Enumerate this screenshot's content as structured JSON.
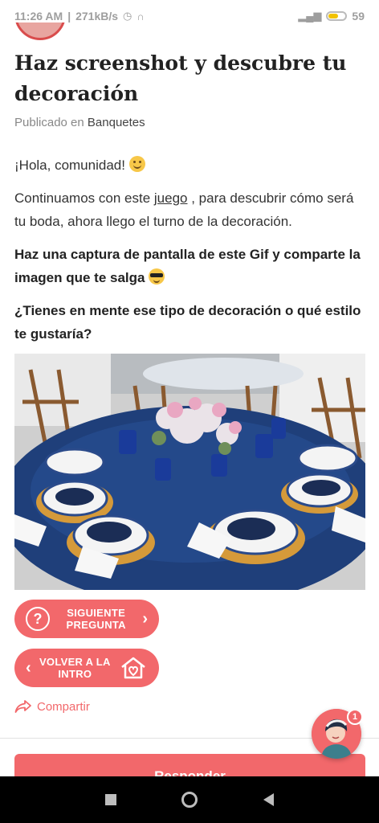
{
  "status_bar": {
    "time": "11:26 AM",
    "speed": "271kB/s",
    "battery": "59",
    "battery_level": 0.59
  },
  "article": {
    "title": "Haz screenshot y descubre tu decoración",
    "published_prefix": "Publicado en",
    "category": "Banquetes",
    "greeting": "¡Hola, comunidad!",
    "para1_before": "Continuamos con este ",
    "para1_link": "juego",
    "para1_after": " , para descubrir cómo será tu boda, ahora llego el turno de la decoración.",
    "para2": "Haz una captura de pantalla de este Gif y comparte la imagen que te salga",
    "para3": "¿Tienes en mente ese tipo de decoración o qué estilo te gustaría?"
  },
  "buttons": {
    "next": "SIGUIENTE PREGUNTA",
    "back": "VOLVER A LA INTRO",
    "share": "Compartir",
    "reply": "Responder"
  },
  "fab": {
    "badge": "1"
  },
  "icons": {
    "status": [
      "alarm-icon",
      "headset-icon",
      "signal-icon",
      "battery-icon"
    ],
    "buttons": [
      "question-icon",
      "chevron-right-icon",
      "chevron-left-icon",
      "home-heart-icon",
      "share-icon"
    ],
    "nav": [
      "recents-icon",
      "home-icon",
      "back-icon"
    ]
  },
  "colors": {
    "accent": "#f2686b",
    "tablecloth": "#1f3f7a"
  }
}
